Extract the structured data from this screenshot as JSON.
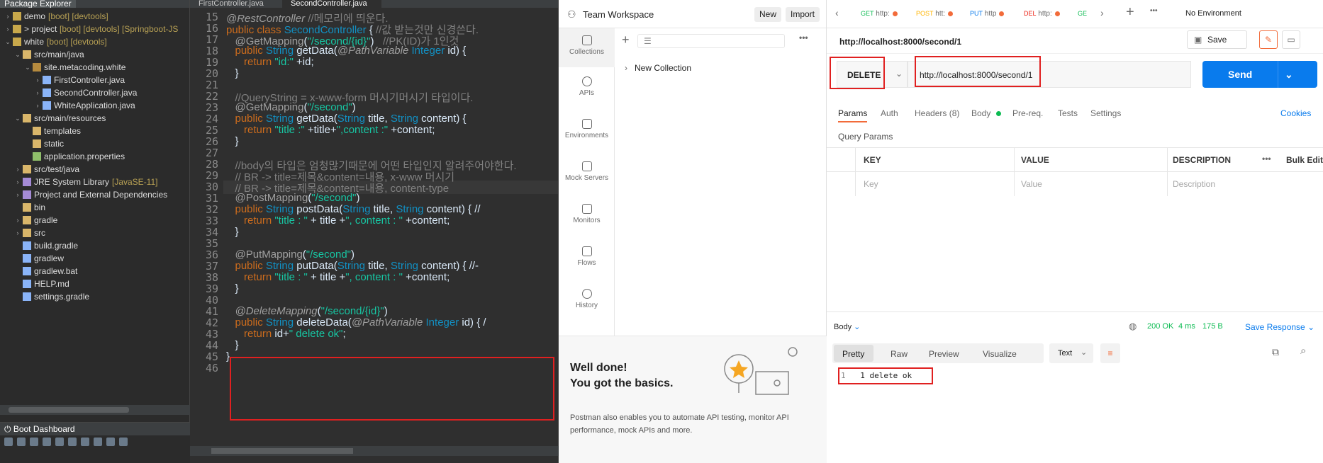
{
  "eclipse": {
    "package_explorer_title": "Package Explorer",
    "tree": [
      {
        "label": "demo",
        "suffix": "[boot] [devtools]",
        "depth": 0,
        "arrow": "›",
        "icon": "project"
      },
      {
        "label": "> project",
        "suffix": "[boot] [devtools] [Springboot-JS",
        "depth": 0,
        "arrow": "›",
        "icon": "project"
      },
      {
        "label": "white",
        "suffix": "[boot] [devtools]",
        "depth": 0,
        "arrow": "⌄",
        "icon": "project"
      },
      {
        "label": "src/main/java",
        "suffix": "",
        "depth": 1,
        "arrow": "⌄",
        "icon": "folder"
      },
      {
        "label": "site.metacoding.white",
        "suffix": "",
        "depth": 2,
        "arrow": "⌄",
        "icon": "package"
      },
      {
        "label": "FirstController.java",
        "suffix": "",
        "depth": 3,
        "arrow": "›",
        "icon": "file"
      },
      {
        "label": "SecondController.java",
        "suffix": "",
        "depth": 3,
        "arrow": "›",
        "icon": "file"
      },
      {
        "label": "WhiteApplication.java",
        "suffix": "",
        "depth": 3,
        "arrow": "›",
        "icon": "file"
      },
      {
        "label": "src/main/resources",
        "suffix": "",
        "depth": 1,
        "arrow": "⌄",
        "icon": "folder"
      },
      {
        "label": "templates",
        "suffix": "",
        "depth": 2,
        "arrow": "",
        "icon": "folder"
      },
      {
        "label": "static",
        "suffix": "",
        "depth": 2,
        "arrow": "",
        "icon": "folder"
      },
      {
        "label": "application.properties",
        "suffix": "",
        "depth": 2,
        "arrow": "",
        "icon": "props"
      },
      {
        "label": "src/test/java",
        "suffix": "",
        "depth": 1,
        "arrow": "›",
        "icon": "folder"
      },
      {
        "label": "JRE System Library",
        "suffix": "[JavaSE-11]",
        "depth": 1,
        "arrow": "›",
        "icon": "lib"
      },
      {
        "label": "Project and External Dependencies",
        "suffix": "",
        "depth": 1,
        "arrow": "›",
        "icon": "lib"
      },
      {
        "label": "bin",
        "suffix": "",
        "depth": 1,
        "arrow": "",
        "icon": "folder"
      },
      {
        "label": "gradle",
        "suffix": "",
        "depth": 1,
        "arrow": "›",
        "icon": "folder"
      },
      {
        "label": "src",
        "suffix": "",
        "depth": 1,
        "arrow": "›",
        "icon": "folder"
      },
      {
        "label": "build.gradle",
        "suffix": "",
        "depth": 1,
        "arrow": "",
        "icon": "file"
      },
      {
        "label": "gradlew",
        "suffix": "",
        "depth": 1,
        "arrow": "",
        "icon": "file"
      },
      {
        "label": "gradlew.bat",
        "suffix": "",
        "depth": 1,
        "arrow": "",
        "icon": "file"
      },
      {
        "label": "HELP.md",
        "suffix": "",
        "depth": 1,
        "arrow": "",
        "icon": "file"
      },
      {
        "label": "settings.gradle",
        "suffix": "",
        "depth": 1,
        "arrow": "",
        "icon": "file"
      }
    ],
    "boot_dashboard_title": "Boot Dashboard",
    "editor_tabs": [
      "FirstController.java",
      "SecondController.java"
    ],
    "line_numbers": [
      "15",
      "16",
      "17",
      "18",
      "19",
      "20",
      "21",
      "22",
      "23",
      "24",
      "25",
      "26",
      "27",
      "28",
      "29",
      "30",
      "31",
      "32",
      "33",
      "34",
      "35",
      "36",
      "37",
      "38",
      "39",
      "40",
      "41",
      "42",
      "43",
      "44",
      "45",
      "46"
    ],
    "code": {
      "l15a": "@RestController",
      "l15b": " //메모리에 띄운다.",
      "l16a": "public class ",
      "l16b": "SecondController",
      "l16c": " { ",
      "l16d": "//값 받는것만 신경쓴다.",
      "l17a": "   @GetMapping",
      "l17b": "(",
      "l17c": "\"/second/{id}\"",
      "l17d": ")   ",
      "l17e": "//PK(ID)가 1인것",
      "l18a": "   public ",
      "l18b": "String",
      "l18c": " getData(",
      "l18d": "@PathVariable",
      "l18e": " Integer",
      "l18f": " id) {",
      "l19a": "      return ",
      "l19b": "\"id:\"",
      "l19c": " +id;",
      "l20": "   }",
      "l22": "   //QueryString = x-www-form 머시기머시기 타입이다.",
      "l23a": "   @GetMapping",
      "l23b": "(",
      "l23c": "\"/second\"",
      "l23d": ")",
      "l24a": "   public ",
      "l24b": "String",
      "l24c": " getData(",
      "l24d": "String",
      "l24e": " title, ",
      "l24f": "String",
      "l24g": " content) {",
      "l25a": "      return ",
      "l25b": "\"title :\"",
      "l25c": " +title+",
      "l25d": "\",content :\"",
      "l25e": " +content;",
      "l26": "   }",
      "l28": "   //body의 타입은 엄청많기때문에 어떤 타입인지 알려주어야한다.",
      "l29": "   // BR -> title=제목&content=내용, x-www 머시기",
      "l30": "   // BR -> title=제목&content=내용, content-type",
      "l31a": "   @PostMapping",
      "l31b": "(",
      "l31c": "\"/second\"",
      "l31d": ")",
      "l32a": "   public ",
      "l32b": "String",
      "l32c": " postData(",
      "l32d": "String",
      "l32e": " title, ",
      "l32f": "String",
      "l32g": " content) { //",
      "l33a": "      return ",
      "l33b": "\"title : \"",
      "l33c": " + title +",
      "l33d": "\", content : \"",
      "l33e": " +content;",
      "l34": "   }",
      "l36a": "   @PutMapping",
      "l36b": "(",
      "l36c": "\"/second\"",
      "l36d": ")",
      "l37a": "   public ",
      "l37b": "String",
      "l37c": " putData(",
      "l37d": "String",
      "l37e": " title, ",
      "l37f": "String",
      "l37g": " content) { //-",
      "l38a": "      return ",
      "l38b": "\"title : \"",
      "l38c": " + title +",
      "l38d": "\", content : \"",
      "l38e": " +content;",
      "l39": "   }",
      "l41a": "   @DeleteMapping",
      "l41b": "(",
      "l41c": "\"/second/{id}\"",
      "l41d": ")",
      "l42a": "   public ",
      "l42b": "String",
      "l42c": " deleteData(",
      "l42d": "@PathVariable",
      "l42e": " Integer",
      "l42f": " id) { /",
      "l43a": "      return ",
      "l43b": "id+",
      "l43c": "\" delete ok\"",
      "l43d": ";",
      "l44": "   }",
      "l45": "}"
    }
  },
  "postman": {
    "workspace": "Team Workspace",
    "new_btn": "New",
    "import_btn": "Import",
    "nav": [
      "Collections",
      "APIs",
      "Environments",
      "Mock Servers",
      "Monitors",
      "Flows",
      "History"
    ],
    "new_collection": "New Collection",
    "welcome_title1": "Well done!",
    "welcome_title2": "You got the basics.",
    "welcome_text": "Postman also enables you to automate API testing, monitor API performance, mock APIs and more.",
    "tabs": [
      {
        "method": "GET",
        "text": "http:",
        "color": "#0cbb52"
      },
      {
        "method": "POST",
        "text": "htt:",
        "color": "#ffb400"
      },
      {
        "method": "PUT",
        "text": "http",
        "color": "#097bed"
      },
      {
        "method": "DEL",
        "text": "http:",
        "color": "#eb2013"
      },
      {
        "method": "GE",
        "text": "",
        "color": "#0cbb52"
      }
    ],
    "env": "No Environment",
    "req_title": "http://localhost:8000/second/1",
    "save": "Save",
    "method": "DELETE",
    "url": "http://localhost:8000/second/1",
    "send": "Send",
    "subtabs": {
      "params": "Params",
      "auth": "Auth",
      "headers": "Headers (8)",
      "body": "Body",
      "prereq": "Pre-req.",
      "tests": "Tests",
      "settings": "Settings",
      "cookies": "Cookies"
    },
    "query_params": "Query Params",
    "cols": {
      "key": "KEY",
      "value": "VALUE",
      "desc": "DESCRIPTION",
      "bulk": "Bulk Edit"
    },
    "placeholders": {
      "key": "Key",
      "value": "Value",
      "desc": "Description"
    },
    "response": {
      "body": "Body",
      "status": "200 OK",
      "time": "4 ms",
      "size": "175 B",
      "save_response": "Save Response",
      "views": [
        "Pretty",
        "Raw",
        "Preview",
        "Visualize"
      ],
      "format": "Text",
      "line_no": "1",
      "line_text": "1 delete ok"
    }
  }
}
